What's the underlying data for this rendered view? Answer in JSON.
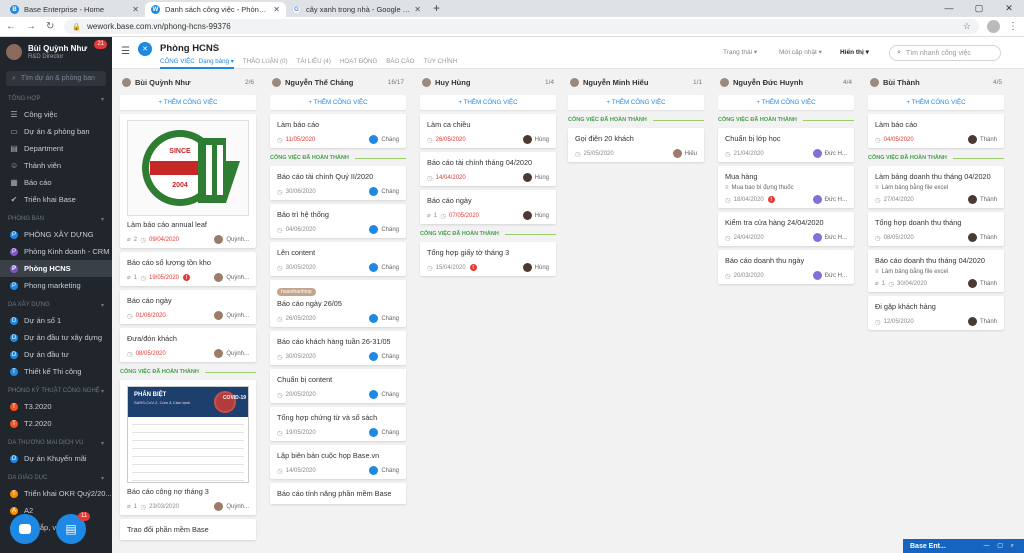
{
  "browser": {
    "tabs": [
      {
        "title": "Base Enterprise - Home",
        "fav_color": "#1e88e5",
        "fav": "B"
      },
      {
        "title": "Danh sách công việc - Phòng HCNS",
        "fav_color": "#1e88e5",
        "fav": "W"
      },
      {
        "title": "cây xanh trong nhà - Google Tìm...",
        "fav_color": "#ffffff",
        "fav": "G"
      }
    ],
    "new_tab": "+",
    "url": "wework.base.com.vn/phong-hcns-99376"
  },
  "sidebar": {
    "user_name": "Bùi Quỳnh Như",
    "user_role": "R&D Director",
    "notif_count": "21",
    "search_placeholder": "Tìm dự án & phòng ban",
    "sections": {
      "s1": "TỔNG HỢP",
      "s2": "PHÒNG BAN",
      "s3": "DA XÂY DỰNG",
      "s4": "PHÒNG KỸ THUẬT CÔNG NGHỆ",
      "s5": "DA THƯƠNG MẠI DỊCH VỤ",
      "s6": "DA GIÁO DỤC"
    },
    "general": [
      {
        "label": "Công việc",
        "icon": "checklist-icon",
        "glyph": "☰"
      },
      {
        "label": "Dự án & phòng ban",
        "icon": "folder-icon",
        "glyph": "▭"
      },
      {
        "label": "Department",
        "icon": "department-icon",
        "glyph": "▤"
      },
      {
        "label": "Thành viên",
        "icon": "members-icon",
        "glyph": "☺"
      },
      {
        "label": "Báo cáo",
        "icon": "report-icon",
        "glyph": "▦"
      },
      {
        "label": "Triển khai Base",
        "icon": "deploy-icon",
        "glyph": "✔"
      }
    ],
    "departments": [
      {
        "label": "PHÒNG XÂY DỰNG",
        "color": "#1e88e5",
        "letter": "P"
      },
      {
        "label": "Phòng Kinh doanh - CRM",
        "color": "#7e57c2",
        "letter": "P"
      },
      {
        "label": "Phòng HCNS",
        "color": "#7e57c2",
        "letter": "P"
      },
      {
        "label": "Phong marketing",
        "color": "#1e88e5",
        "letter": "P"
      }
    ],
    "construction": [
      {
        "label": "Dự án số 1",
        "color": "#1e88e5",
        "letter": "D"
      },
      {
        "label": "Dự án đầu tư xây dựng",
        "color": "#1e88e5",
        "letter": "D"
      },
      {
        "label": "Dự án đầu tư",
        "color": "#1e88e5",
        "letter": "D"
      },
      {
        "label": "Thiết kế Thi công",
        "color": "#1e88e5",
        "letter": "T"
      }
    ],
    "tech": [
      {
        "label": "T3.2020",
        "color": "#f4511e",
        "letter": "T"
      },
      {
        "label": "T2.2020",
        "color": "#f4511e",
        "letter": "T"
      }
    ],
    "trade": [
      {
        "label": "Dự án Khuyến mãi",
        "color": "#1e88e5",
        "letter": "D"
      }
    ],
    "edu": [
      {
        "label": "Triển khai OKR Quý2/20...",
        "color": "#fb8c00",
        "letter": "T"
      },
      {
        "label": "A2",
        "color": "#fb8c00",
        "letter": "A"
      },
      {
        "label": "Tư bắp, vệ sinh",
        "color": "#fb8c00",
        "letter": "T"
      }
    ],
    "task_count": "11"
  },
  "header": {
    "title": "Phòng HCNS",
    "tabs": [
      {
        "label": "CÔNG VIỆC",
        "sub": "Dạng bảng ▾"
      },
      {
        "label": "THẢO LUẬN (0)",
        "sub": ""
      },
      {
        "label": "TÀI LIỆU (4)",
        "sub": ""
      },
      {
        "label": "HOẠT ĐỘNG",
        "sub": ""
      },
      {
        "label": "BÁO CÁO",
        "sub": ""
      },
      {
        "label": "TÙY CHỈNH",
        "sub": ""
      }
    ],
    "status_filter": "Trạng thái ▾",
    "sort": "Mới cập nhật ▾",
    "display": "Hiển thị ▾",
    "search_placeholder": "Tìm nhanh công việc"
  },
  "board": {
    "add_label": "+ THÊM CÔNG VIỆC",
    "done_label": "CÔNG VIỆC ĐÃ HOÀN THÀNH",
    "columns": [
      {
        "name": "Bùi Quỳnh Như",
        "count": "2/6",
        "cards": [
          {
            "title": "Làm báo cáo annual leaf",
            "image": "logo",
            "comments": "2",
            "date": "09/04/2020",
            "late": true,
            "assignee": "Quỳnh...",
            "av": "b"
          },
          {
            "title": "Báo cáo số lượng tồn kho",
            "comments": "1",
            "date": "19/05/2020",
            "late": true,
            "warn": true,
            "assignee": "Quỳnh...",
            "av": "b"
          },
          {
            "title": "Báo cáo ngày",
            "date": "01/06/2020",
            "late": true,
            "assignee": "Quỳnh...",
            "av": "b"
          },
          {
            "title": "Đưa/đón khách",
            "date": "08/05/2020",
            "late": true,
            "assignee": "Quỳnh...",
            "av": "b"
          }
        ],
        "done": [
          {
            "title": "Báo cáo công nợ tháng 3",
            "image": "covid",
            "comments": "1",
            "date": "23/03/2020",
            "assignee": "Quỳnh...",
            "av": "b"
          },
          {
            "title": "Trao đổi phần mềm Base"
          }
        ]
      },
      {
        "name": "Nguyễn Thế Cháng",
        "count": "16/17",
        "cards": [
          {
            "title": "Làm báo cáo",
            "date": "11/05/2020",
            "late": true,
            "assignee": "Cháng",
            "av": "p"
          }
        ],
        "done": [
          {
            "title": "Báo cáo tài chính Quý II/2020",
            "date": "30/06/2020",
            "assignee": "Cháng",
            "av": "p"
          },
          {
            "title": "Bảo trì hệ thống",
            "date": "04/06/2020",
            "assignee": "Cháng",
            "av": "p"
          },
          {
            "title": "Lên content",
            "date": "30/05/2020",
            "assignee": "Cháng",
            "av": "p"
          },
          {
            "title": "Báo cáo ngày 26/05",
            "tag": "hoanthanhtop",
            "date": "26/05/2020",
            "assignee": "Cháng",
            "av": "p"
          },
          {
            "title": "Báo cáo khách hàng tuần 26-31/05",
            "date": "30/05/2020",
            "assignee": "Cháng",
            "av": "p"
          },
          {
            "title": "Chuẩn bị content",
            "date": "20/05/2020",
            "assignee": "Cháng",
            "av": "p"
          },
          {
            "title": "Tổng hợp chứng từ và sổ sách",
            "date": "19/05/2020",
            "assignee": "Cháng",
            "av": "p"
          },
          {
            "title": "Lập biên bản cuộc họp Base.vn",
            "date": "14/05/2020",
            "assignee": "Cháng",
            "av": "p"
          },
          {
            "title": "Báo cáo tính năng phần mềm Base"
          }
        ]
      },
      {
        "name": "Huy Hùng",
        "count": "1/4",
        "cards": [
          {
            "title": "Làm ca chiều",
            "date": "26/05/2020",
            "late": true,
            "assignee": "Hùng",
            "av": "d"
          },
          {
            "title": "Báo cáo tài chính tháng 04/2020",
            "date": "14/04/2020",
            "late": true,
            "assignee": "Hùng",
            "av": "d"
          },
          {
            "title": "Báo cáo ngày",
            "comments": "1",
            "date": "07/05/2020",
            "late": true,
            "assignee": "Hùng",
            "av": "d"
          }
        ],
        "done": [
          {
            "title": "Tổng hợp giấy tờ tháng 3",
            "date": "15/04/2020",
            "warn": true,
            "assignee": "Hùng",
            "av": "d"
          }
        ]
      },
      {
        "name": "Nguyễn Minh Hiếu",
        "count": "1/1",
        "cards": [],
        "done": [
          {
            "title": "Gọi điện 20 khách",
            "date": "25/05/2020",
            "assignee": "Hiếu",
            "av": "b"
          }
        ]
      },
      {
        "name": "Nguyễn Đức Huynh",
        "count": "4/4",
        "cards": [],
        "done": [
          {
            "title": "Chuẩn bị lớp học",
            "date": "21/04/2020",
            "assignee": "Đức H...",
            "av": "v"
          },
          {
            "title": "Mua hàng",
            "note": "Mua bao bì đựng thuốc",
            "date": "18/04/2020",
            "warn": true,
            "assignee": "Đức H...",
            "av": "v"
          },
          {
            "title": "Kiểm tra cửa hàng 24/04/2020",
            "date": "24/04/2020",
            "assignee": "Đức H...",
            "av": "v"
          },
          {
            "title": "Báo cáo doanh thu ngày",
            "date": "20/03/2020",
            "assignee": "Đức H...",
            "av": "v"
          }
        ]
      },
      {
        "name": "Bùi Thành",
        "count": "4/5",
        "cards": [
          {
            "title": "Làm báo cáo",
            "date": "04/05/2020",
            "late": true,
            "assignee": "Thành",
            "av": "d"
          }
        ],
        "done": [
          {
            "title": "Làm bảng doanh thu tháng 04/2020",
            "note": "Làm bảng bằng file excel",
            "date": "27/04/2020",
            "assignee": "Thành",
            "av": "d"
          },
          {
            "title": "Tổng hợp doanh thu tháng",
            "date": "08/05/2020",
            "assignee": "Thành",
            "av": "d"
          },
          {
            "title": "Báo cáo doanh thu tháng 04/2020",
            "note": "Làm bảng bằng file excel",
            "comments": "1",
            "date": "30/04/2020",
            "assignee": "Thành",
            "av": "d"
          },
          {
            "title": "Đi gặp khách hàng",
            "date": "12/05/2020",
            "assignee": "Thành",
            "av": "d"
          }
        ]
      }
    ]
  },
  "logo_image": {
    "since": "SINCE",
    "year": "2004"
  },
  "covid_image": {
    "title": "PHÂN BIỆT",
    "subtitle": "SARS-CoV-2, Cúm & Cảm lạnh",
    "badge": "COVID-19"
  },
  "taskbar": {
    "label": "Base Ent...",
    "icons": "— ▢ ⌕"
  },
  "colors": {
    "accent": "#1e88e5",
    "late": "#e53935",
    "done": "#43a047",
    "sidebar": "#21262d"
  }
}
